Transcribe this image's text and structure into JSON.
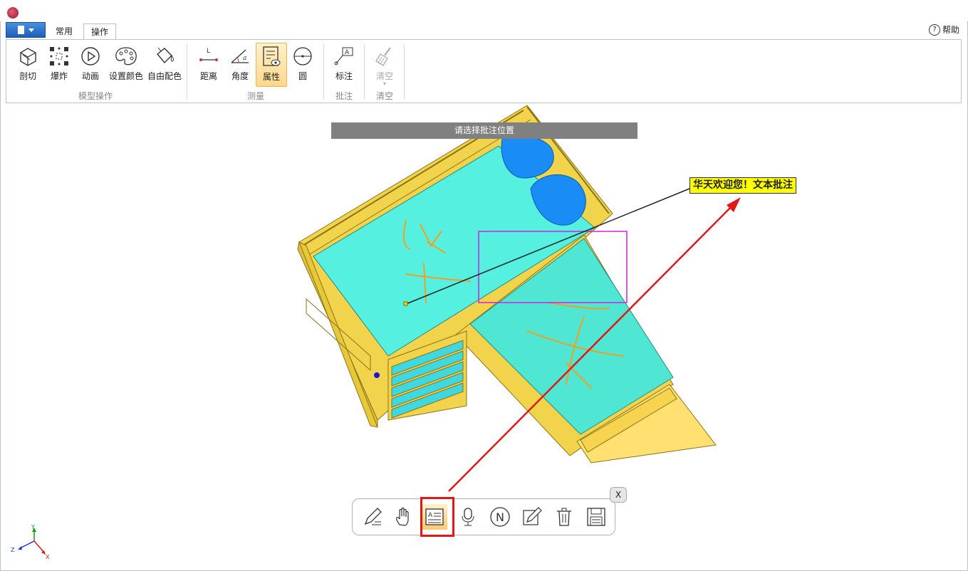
{
  "tabs": {
    "common": "常用",
    "operate": "操作"
  },
  "help": {
    "label": "帮助",
    "icon": "question-circle-icon"
  },
  "ribbon": {
    "model_group": {
      "label": "模型操作",
      "items": [
        "剖切",
        "爆炸",
        "动画",
        "设置颜色",
        "自由配色"
      ]
    },
    "measure_group": {
      "label": "测量",
      "items": [
        "距离",
        "角度",
        "属性",
        "圆"
      ]
    },
    "annotate_group": {
      "label": "批注",
      "items": [
        "标注"
      ]
    },
    "clear_group": {
      "label": "清空",
      "items": [
        "清空"
      ]
    }
  },
  "viewport": {
    "prompt": "请选择批注位置",
    "annotation_text": "华天欢迎您！文本批注",
    "axes": {
      "y": "Y",
      "z": "Z",
      "x": "X"
    }
  },
  "annotation_toolbar": {
    "close_label": "X",
    "tools": [
      "pen-icon",
      "hand-icon",
      "text-annotation-icon",
      "microphone-icon",
      "n-circle-icon",
      "edit-icon",
      "trash-icon",
      "save-icon"
    ]
  },
  "colors": {
    "accent": "#ffd88a",
    "highlight_box": "#e01818",
    "selection": "#d020e0",
    "model": "#40e8d8",
    "frame": "#f0d060"
  }
}
